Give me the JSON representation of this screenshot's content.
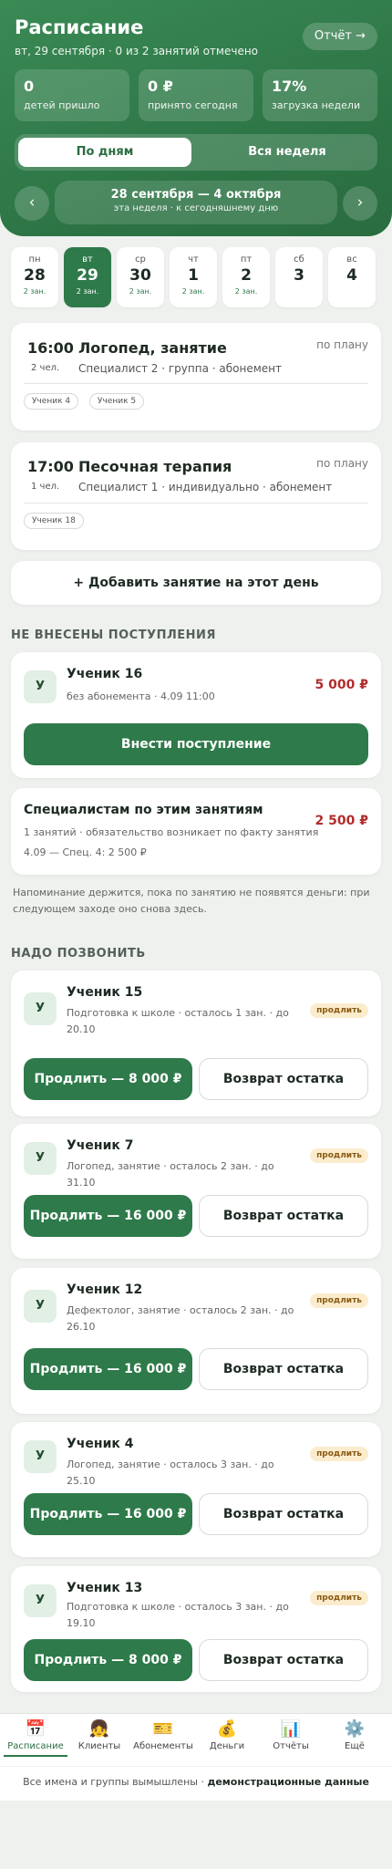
{
  "header": {
    "title": "Расписание",
    "subtitle": "вт, 29 сентября · 0 из 2 занятий отмечено",
    "report_label": "Отчёт →",
    "stats": [
      {
        "value": "0",
        "label": "детей пришло"
      },
      {
        "value": "0 ₽",
        "label": "принято сегодня"
      },
      {
        "value": "17%",
        "label": "загрузка недели"
      }
    ],
    "segments": {
      "active": "По дням",
      "inactive": "Вся неделя"
    },
    "week_range": "28 сентября — 4 октября",
    "week_hint": "эта неделя · к сегодняшнему дню",
    "prev_arrow": "‹",
    "next_arrow": "›"
  },
  "days": [
    {
      "weekday": "пн",
      "num": "28",
      "count": "2 зан."
    },
    {
      "weekday": "вт",
      "num": "29",
      "count": "2 зан."
    },
    {
      "weekday": "ср",
      "num": "30",
      "count": "2 зан."
    },
    {
      "weekday": "чт",
      "num": "1",
      "count": "2 зан."
    },
    {
      "weekday": "пт",
      "num": "2",
      "count": "2 зан."
    },
    {
      "weekday": "сб",
      "num": "3",
      "count": ""
    },
    {
      "weekday": "вс",
      "num": "4",
      "count": ""
    }
  ],
  "lessons": [
    {
      "time": "16:00",
      "people": "2 чел.",
      "title": "Логопед, занятие",
      "sub": "Специалист 2 · группа · абонемент",
      "state": "по плану",
      "students": [
        "Ученик 4",
        "Ученик 5"
      ]
    },
    {
      "time": "17:00",
      "people": "1 чел.",
      "title": "Песочная терапия",
      "sub": "Специалист 1 · индивидуально · абонемент",
      "state": "по плану",
      "students": [
        "Ученик 18"
      ]
    }
  ],
  "add_lesson_label": "+ Добавить занятие на этот день",
  "payments": {
    "section_title": "НЕ ВНЕСЕНЫ ПОСТУПЛЕНИЯ",
    "item": {
      "avatar": "У",
      "name": "Ученик 16",
      "sub": "без абонемента · 4.09 11:00",
      "amount": "5 000 ₽",
      "button": "Внести поступление"
    },
    "specialists": {
      "title": "Специалистам по этим занятиям",
      "line1": "1 занятий · обязательство возникает по факту занятия",
      "line2": "4.09 — Спец. 4: 2 500 ₽",
      "amount": "2 500 ₽"
    },
    "note": "Напоминание держится, пока по занятию не появятся деньги: при следующем заходе оно снова здесь."
  },
  "calls": {
    "section_title": "НАДО ПОЗВОНИТЬ",
    "tag": "продлить",
    "refund_label": "Возврат остатка",
    "items": [
      {
        "avatar": "У",
        "name": "Ученик 15",
        "sub": "Подготовка к школе · осталось 1 зан. · до 20.10",
        "extend": "Продлить — 8 000 ₽"
      },
      {
        "avatar": "У",
        "name": "Ученик 7",
        "sub": "Логопед, занятие · осталось 2 зан. · до 31.10",
        "extend": "Продлить — 16 000 ₽"
      },
      {
        "avatar": "У",
        "name": "Ученик 12",
        "sub": "Дефектолог, занятие · осталось 2 зан. · до 26.10",
        "extend": "Продлить — 16 000 ₽"
      },
      {
        "avatar": "У",
        "name": "Ученик 4",
        "sub": "Логопед, занятие · осталось 3 зан. · до 25.10",
        "extend": "Продлить — 16 000 ₽"
      },
      {
        "avatar": "У",
        "name": "Ученик 13",
        "sub": "Подготовка к школе · осталось 3 зан. · до 19.10",
        "extend": "Продлить — 8 000 ₽"
      }
    ]
  },
  "tabbar": [
    {
      "icon": "📅",
      "label": "Расписание"
    },
    {
      "icon": "👧",
      "label": "Клиенты"
    },
    {
      "icon": "🎫",
      "label": "Абонементы"
    },
    {
      "icon": "💰",
      "label": "Деньги"
    },
    {
      "icon": "📊",
      "label": "Отчёты"
    },
    {
      "icon": "⚙️",
      "label": "Ещё"
    }
  ],
  "footer": {
    "text": "Все имена и группы вымышлены · ",
    "bold": "демонстрационные данные"
  }
}
